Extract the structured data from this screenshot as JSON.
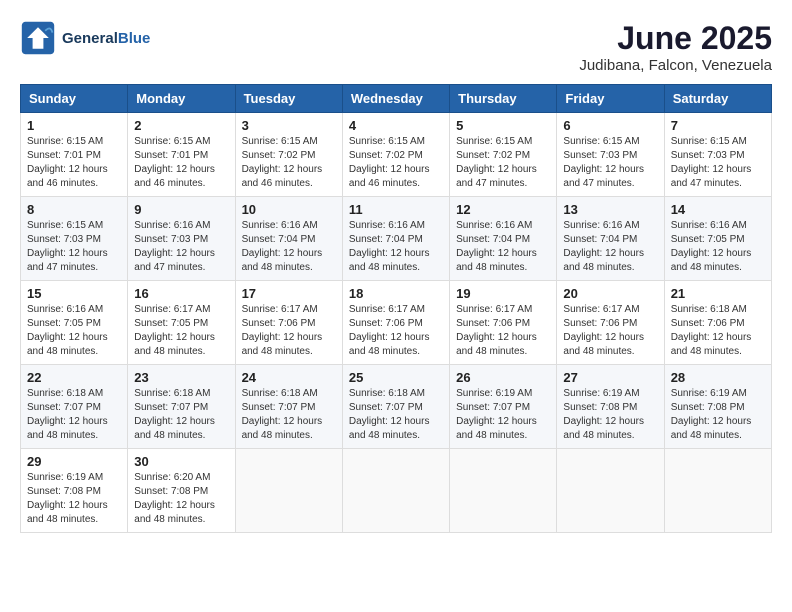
{
  "header": {
    "logo_line1": "General",
    "logo_line2": "Blue",
    "month": "June 2025",
    "location": "Judibana, Falcon, Venezuela"
  },
  "weekdays": [
    "Sunday",
    "Monday",
    "Tuesday",
    "Wednesday",
    "Thursday",
    "Friday",
    "Saturday"
  ],
  "weeks": [
    [
      {
        "day": "1",
        "info": "Sunrise: 6:15 AM\nSunset: 7:01 PM\nDaylight: 12 hours\nand 46 minutes."
      },
      {
        "day": "2",
        "info": "Sunrise: 6:15 AM\nSunset: 7:01 PM\nDaylight: 12 hours\nand 46 minutes."
      },
      {
        "day": "3",
        "info": "Sunrise: 6:15 AM\nSunset: 7:02 PM\nDaylight: 12 hours\nand 46 minutes."
      },
      {
        "day": "4",
        "info": "Sunrise: 6:15 AM\nSunset: 7:02 PM\nDaylight: 12 hours\nand 46 minutes."
      },
      {
        "day": "5",
        "info": "Sunrise: 6:15 AM\nSunset: 7:02 PM\nDaylight: 12 hours\nand 47 minutes."
      },
      {
        "day": "6",
        "info": "Sunrise: 6:15 AM\nSunset: 7:03 PM\nDaylight: 12 hours\nand 47 minutes."
      },
      {
        "day": "7",
        "info": "Sunrise: 6:15 AM\nSunset: 7:03 PM\nDaylight: 12 hours\nand 47 minutes."
      }
    ],
    [
      {
        "day": "8",
        "info": "Sunrise: 6:15 AM\nSunset: 7:03 PM\nDaylight: 12 hours\nand 47 minutes."
      },
      {
        "day": "9",
        "info": "Sunrise: 6:16 AM\nSunset: 7:03 PM\nDaylight: 12 hours\nand 47 minutes."
      },
      {
        "day": "10",
        "info": "Sunrise: 6:16 AM\nSunset: 7:04 PM\nDaylight: 12 hours\nand 48 minutes."
      },
      {
        "day": "11",
        "info": "Sunrise: 6:16 AM\nSunset: 7:04 PM\nDaylight: 12 hours\nand 48 minutes."
      },
      {
        "day": "12",
        "info": "Sunrise: 6:16 AM\nSunset: 7:04 PM\nDaylight: 12 hours\nand 48 minutes."
      },
      {
        "day": "13",
        "info": "Sunrise: 6:16 AM\nSunset: 7:04 PM\nDaylight: 12 hours\nand 48 minutes."
      },
      {
        "day": "14",
        "info": "Sunrise: 6:16 AM\nSunset: 7:05 PM\nDaylight: 12 hours\nand 48 minutes."
      }
    ],
    [
      {
        "day": "15",
        "info": "Sunrise: 6:16 AM\nSunset: 7:05 PM\nDaylight: 12 hours\nand 48 minutes."
      },
      {
        "day": "16",
        "info": "Sunrise: 6:17 AM\nSunset: 7:05 PM\nDaylight: 12 hours\nand 48 minutes."
      },
      {
        "day": "17",
        "info": "Sunrise: 6:17 AM\nSunset: 7:06 PM\nDaylight: 12 hours\nand 48 minutes."
      },
      {
        "day": "18",
        "info": "Sunrise: 6:17 AM\nSunset: 7:06 PM\nDaylight: 12 hours\nand 48 minutes."
      },
      {
        "day": "19",
        "info": "Sunrise: 6:17 AM\nSunset: 7:06 PM\nDaylight: 12 hours\nand 48 minutes."
      },
      {
        "day": "20",
        "info": "Sunrise: 6:17 AM\nSunset: 7:06 PM\nDaylight: 12 hours\nand 48 minutes."
      },
      {
        "day": "21",
        "info": "Sunrise: 6:18 AM\nSunset: 7:06 PM\nDaylight: 12 hours\nand 48 minutes."
      }
    ],
    [
      {
        "day": "22",
        "info": "Sunrise: 6:18 AM\nSunset: 7:07 PM\nDaylight: 12 hours\nand 48 minutes."
      },
      {
        "day": "23",
        "info": "Sunrise: 6:18 AM\nSunset: 7:07 PM\nDaylight: 12 hours\nand 48 minutes."
      },
      {
        "day": "24",
        "info": "Sunrise: 6:18 AM\nSunset: 7:07 PM\nDaylight: 12 hours\nand 48 minutes."
      },
      {
        "day": "25",
        "info": "Sunrise: 6:18 AM\nSunset: 7:07 PM\nDaylight: 12 hours\nand 48 minutes."
      },
      {
        "day": "26",
        "info": "Sunrise: 6:19 AM\nSunset: 7:07 PM\nDaylight: 12 hours\nand 48 minutes."
      },
      {
        "day": "27",
        "info": "Sunrise: 6:19 AM\nSunset: 7:08 PM\nDaylight: 12 hours\nand 48 minutes."
      },
      {
        "day": "28",
        "info": "Sunrise: 6:19 AM\nSunset: 7:08 PM\nDaylight: 12 hours\nand 48 minutes."
      }
    ],
    [
      {
        "day": "29",
        "info": "Sunrise: 6:19 AM\nSunset: 7:08 PM\nDaylight: 12 hours\nand 48 minutes."
      },
      {
        "day": "30",
        "info": "Sunrise: 6:20 AM\nSunset: 7:08 PM\nDaylight: 12 hours\nand 48 minutes."
      },
      {
        "day": "",
        "info": ""
      },
      {
        "day": "",
        "info": ""
      },
      {
        "day": "",
        "info": ""
      },
      {
        "day": "",
        "info": ""
      },
      {
        "day": "",
        "info": ""
      }
    ]
  ]
}
